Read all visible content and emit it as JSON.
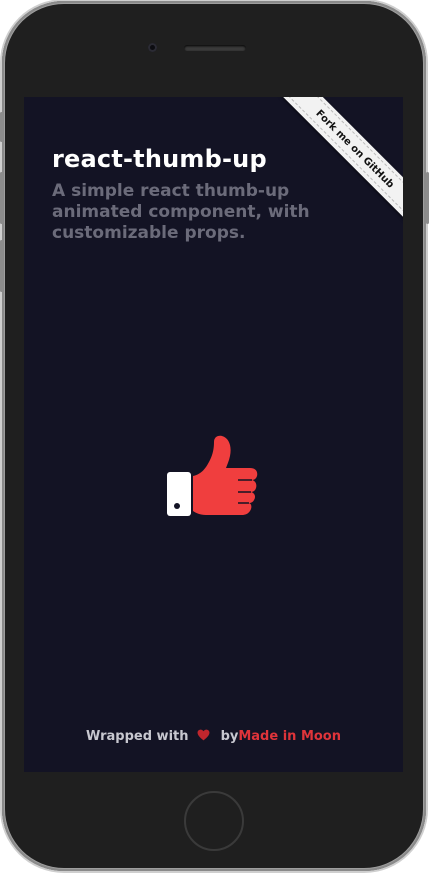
{
  "ribbon": {
    "label": "Fork me on GitHub"
  },
  "header": {
    "title": "react-thumb-up",
    "subtitle": "A simple react thumb-up animated component, with customizable props."
  },
  "thumb": {
    "icon": "thumb-up-icon",
    "color": "#f03e3e",
    "cuff_color": "#ffffff"
  },
  "footer": {
    "prefix": "Wrapped with",
    "heart_icon": "heart-icon",
    "by": "by",
    "link_label": "Made in Moon",
    "link_color": "#e0343a"
  },
  "colors": {
    "background": "#131324",
    "title": "#ffffff",
    "subtitle": "#6b6b7a"
  }
}
